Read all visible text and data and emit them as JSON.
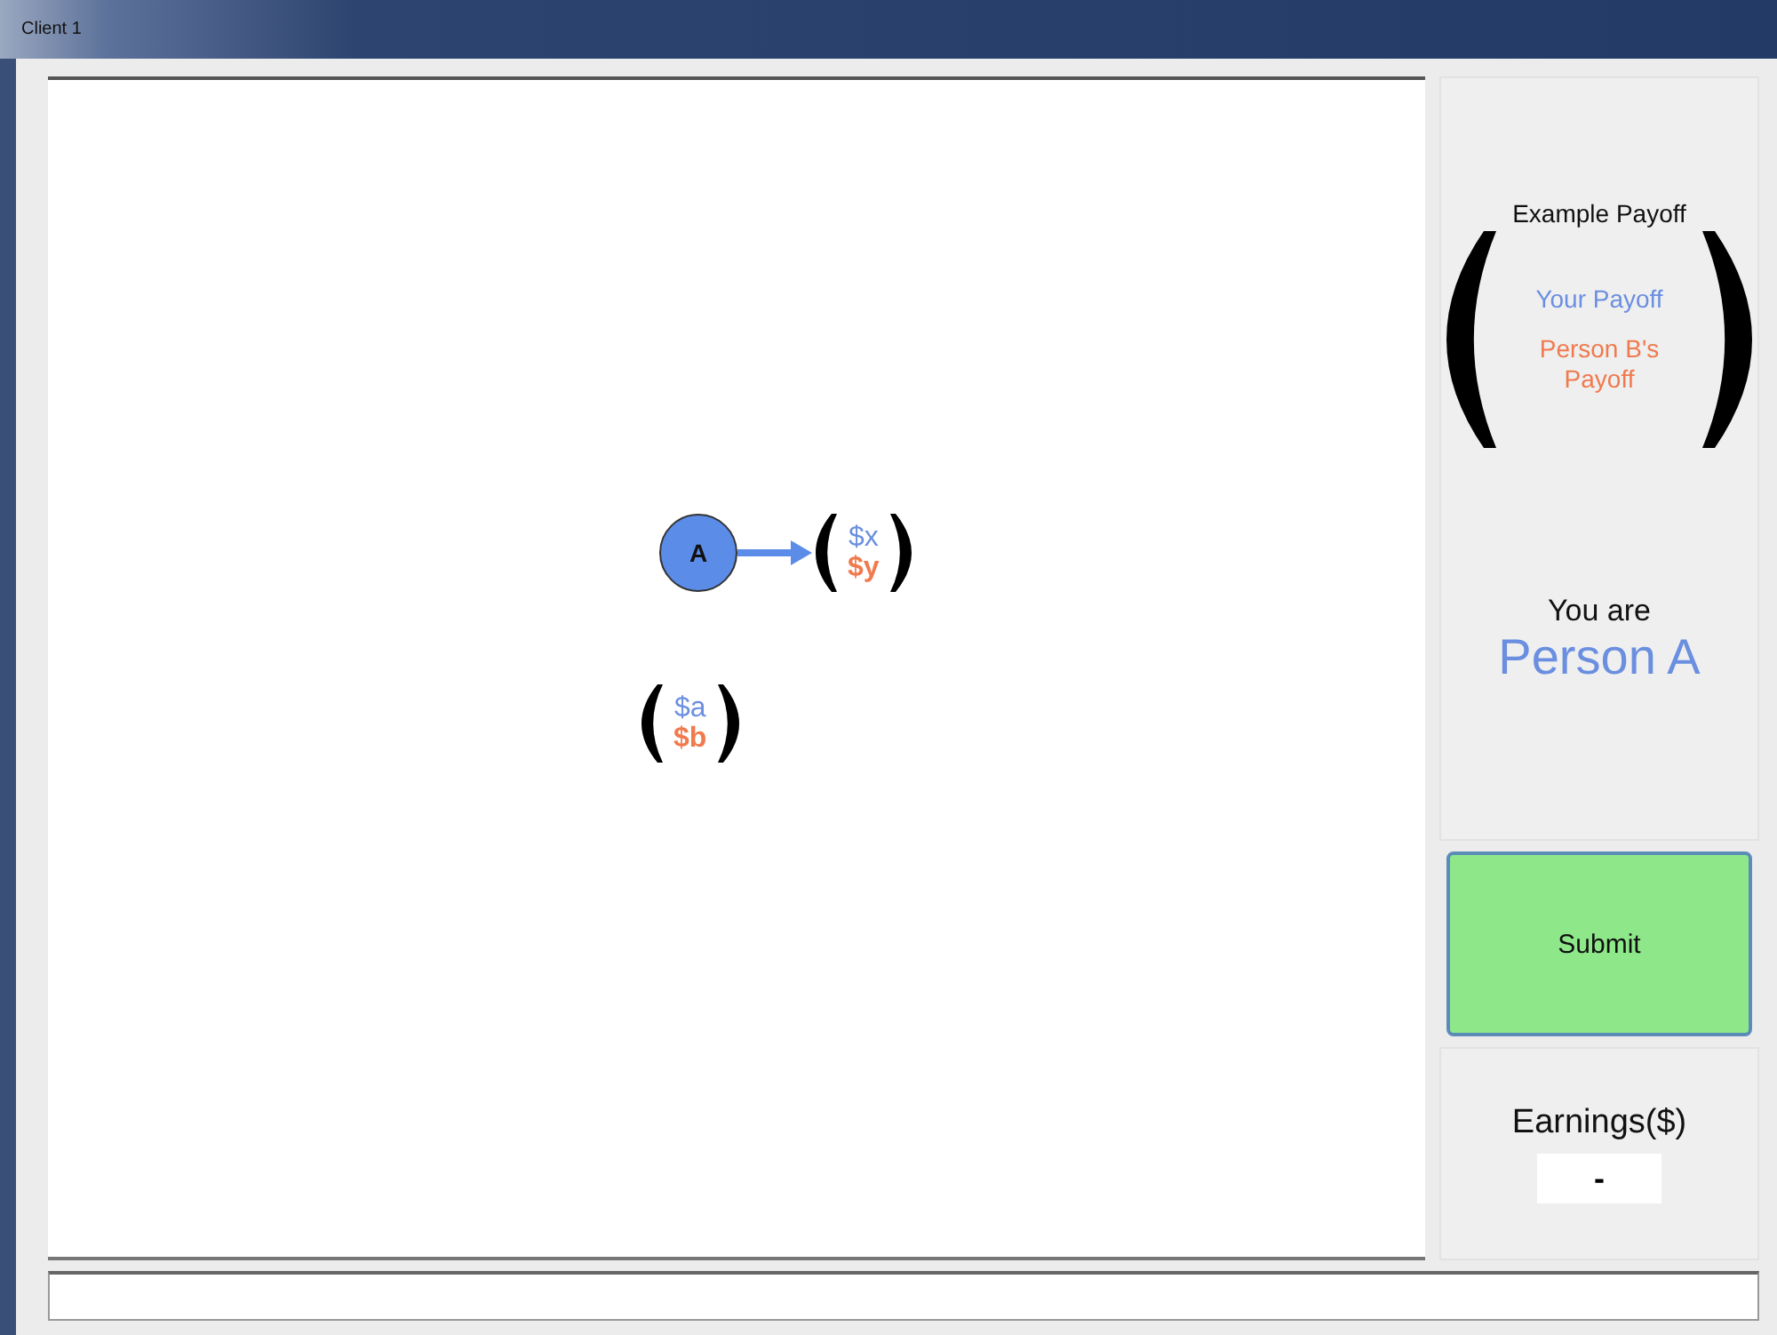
{
  "window": {
    "title": "Client 1"
  },
  "canvas": {
    "nodes": [
      {
        "label": "A"
      }
    ],
    "payoffs": [
      {
        "top": "$x",
        "bottom": "$y"
      },
      {
        "top": "$a",
        "bottom": "$b"
      }
    ]
  },
  "legend": {
    "title": "Example Payoff",
    "your_payoff": "Your Payoff",
    "other_payoff": "Person B's Payoff"
  },
  "role": {
    "label": "You are",
    "value": "Person A"
  },
  "submit": {
    "label": "Submit"
  },
  "earnings": {
    "label": "Earnings($)",
    "value": "-"
  }
}
